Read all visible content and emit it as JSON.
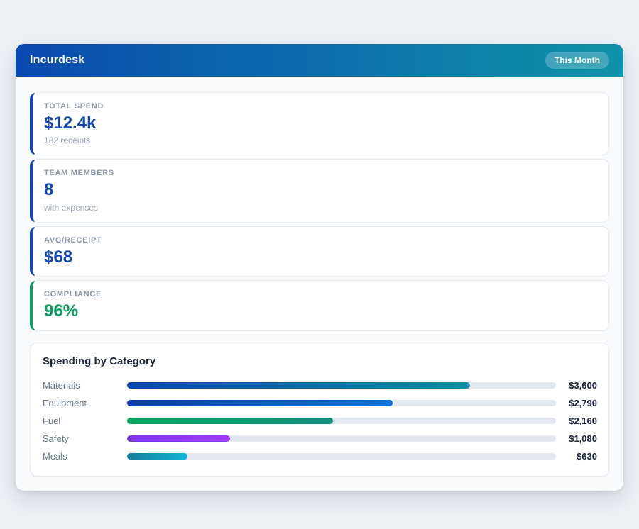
{
  "header": {
    "title": "Incurdesk",
    "badge": "This Month",
    "gradient_start": "#0b4ab0",
    "gradient_end": "#0f93a8"
  },
  "stats": [
    {
      "label": "TOTAL SPEND",
      "value": "$12.4k",
      "sub": "182 receipts",
      "accent": "#1247b5",
      "value_color": "#1247b5"
    },
    {
      "label": "TEAM MEMBERS",
      "value": "8",
      "sub": "with expenses",
      "accent": "#1247b5",
      "value_color": "#1247b5"
    },
    {
      "label": "AVG/RECEIPT",
      "value": "$68",
      "accent": "#1247b5",
      "value_color": "#1247b5"
    },
    {
      "label": "COMPLIANCE",
      "value": "96%",
      "accent": "#0a9e5e",
      "value_color": "#0a9e5e"
    }
  ],
  "chart": {
    "heading": "Spending by Category",
    "track_color": "#e3e8f0",
    "rows": [
      {
        "label": "Materials",
        "value_label": "$3,600",
        "percent": 80,
        "color_start": "#0b45ad",
        "color_end": "#0e8fa4"
      },
      {
        "label": "Equipment",
        "value_label": "$2,790",
        "percent": 62,
        "color_start": "#0d3fa8",
        "color_end": "#0b76d9"
      },
      {
        "label": "Fuel",
        "value_label": "$2,160",
        "percent": 48,
        "color_start": "#0aa35f",
        "color_end": "#12917f"
      },
      {
        "label": "Safety",
        "value_label": "$1,080",
        "percent": 24,
        "color_start": "#7c36e2",
        "color_end": "#9d3bf0"
      },
      {
        "label": "Meals",
        "value_label": "$630",
        "percent": 14,
        "color_start": "#177f9c",
        "color_end": "#0fb3d8"
      }
    ]
  },
  "chart_data": {
    "type": "bar",
    "orientation": "horizontal",
    "title": "Spending by Category",
    "categories": [
      "Materials",
      "Equipment",
      "Fuel",
      "Safety",
      "Meals"
    ],
    "values": [
      3600,
      2790,
      2160,
      1080,
      630
    ],
    "value_labels": [
      "$3,600",
      "$2,790",
      "$2,160",
      "$1,080",
      "$630"
    ],
    "xlim": [
      0,
      4500
    ],
    "grid": false,
    "legend": false
  }
}
